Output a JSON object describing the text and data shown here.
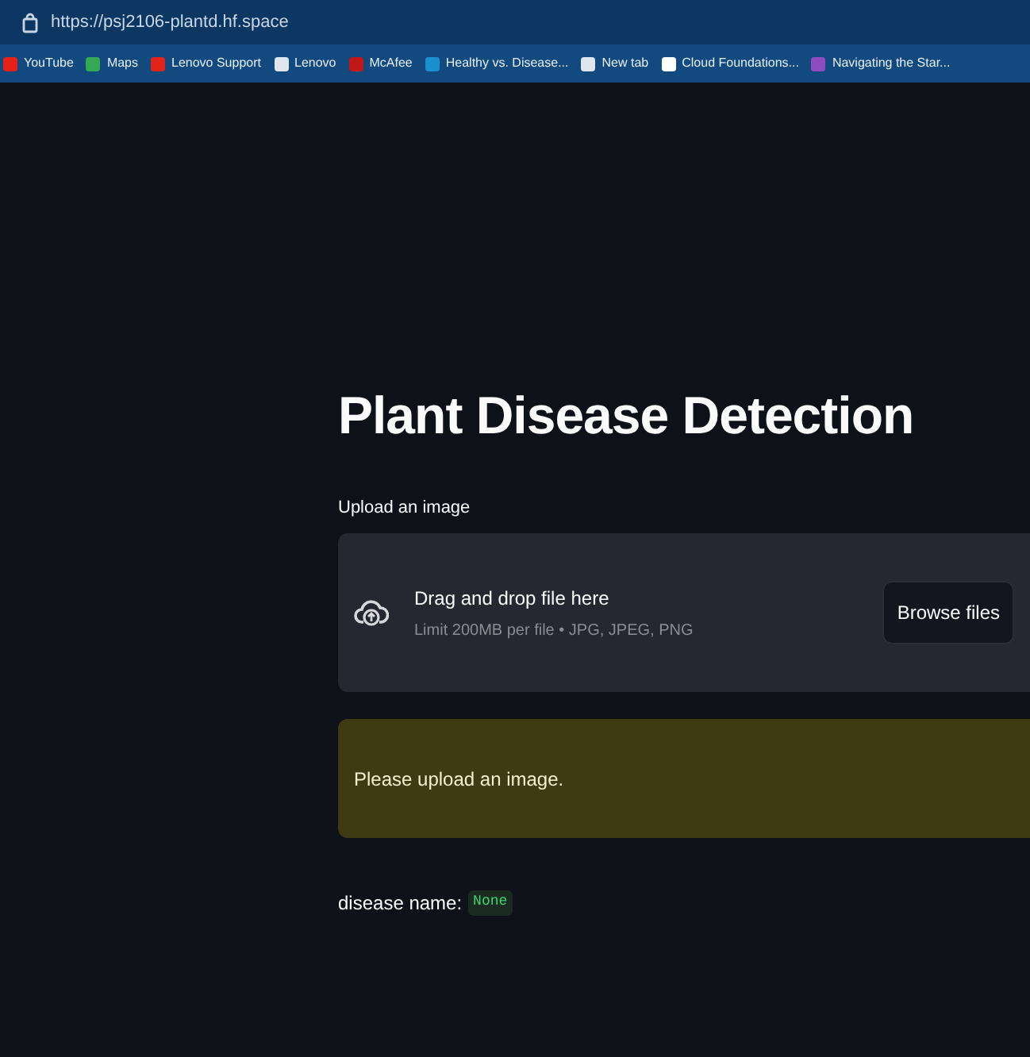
{
  "browser": {
    "url": "https://psj2106-plantd.hf.space",
    "bookmarks": [
      {
        "label": "YouTube",
        "color": "#e62117"
      },
      {
        "label": "Maps",
        "color": "#34a853"
      },
      {
        "label": "Lenovo Support",
        "color": "#e2231a"
      },
      {
        "label": "Lenovo",
        "color": "#dfe6ee"
      },
      {
        "label": "McAfee",
        "color": "#c01818"
      },
      {
        "label": "Healthy vs. Disease...",
        "color": "#1a8fd0"
      },
      {
        "label": "New tab",
        "color": "#dfe6ee"
      },
      {
        "label": "Cloud Foundations...",
        "color": "#ffffff"
      },
      {
        "label": "Navigating the Star...",
        "color": "#8e4cc0"
      }
    ]
  },
  "app": {
    "title": "Plant Disease Detection",
    "uploader": {
      "label": "Upload an image",
      "drop_text": "Drag and drop file here",
      "limit_text": "Limit 200MB per file • JPG, JPEG, PNG",
      "button": "Browse files"
    },
    "alert": "Please upload an image.",
    "result_label": "disease name:",
    "result_value": "None"
  }
}
